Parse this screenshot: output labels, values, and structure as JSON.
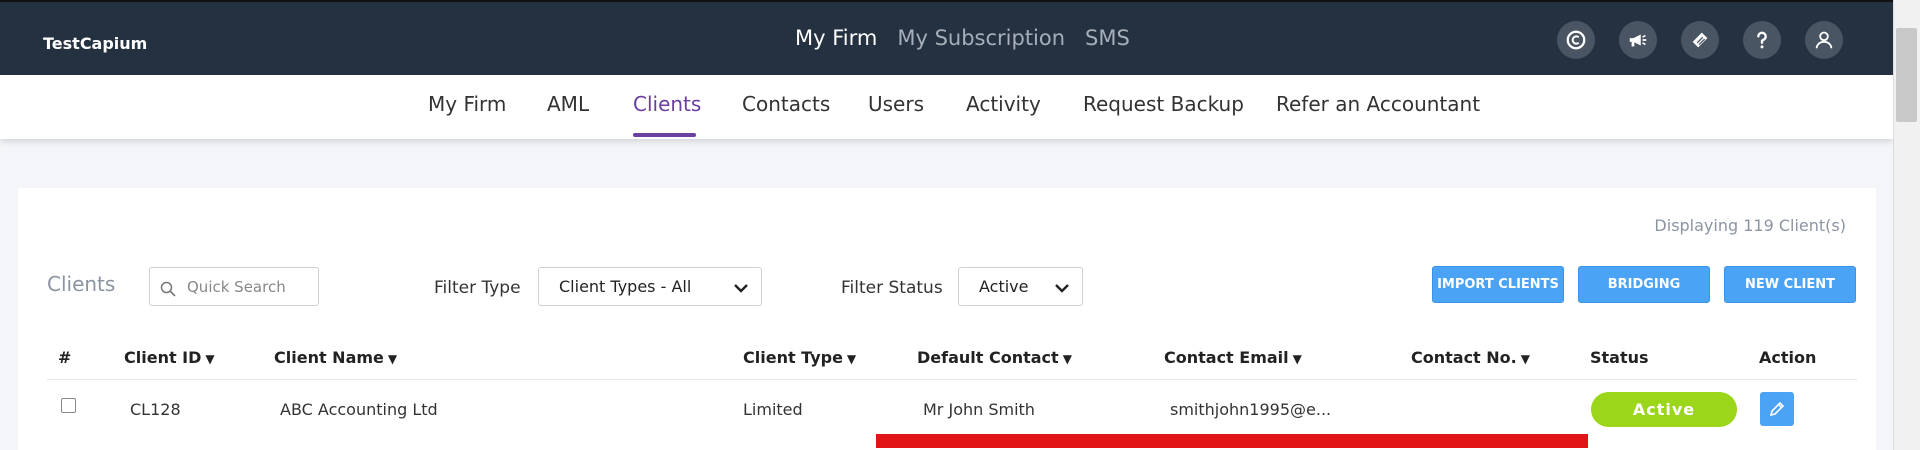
{
  "brand": "TestCapium",
  "top_nav": [
    "My Firm",
    "My Subscription",
    "SMS"
  ],
  "top_nav_active": 0,
  "top_icons": [
    "capium-icon",
    "megaphone-icon",
    "ticket-icon",
    "help-icon",
    "user-icon"
  ],
  "sub_nav": [
    "My Firm",
    "AML",
    "Clients",
    "Contacts",
    "Users",
    "Activity",
    "Request Backup",
    "Refer an Accountant"
  ],
  "sub_nav_active": "Clients",
  "displaying": "Displaying 119 Client(s)",
  "clients_label": "Clients",
  "search_placeholder": "Quick Search",
  "filter_type_label": "Filter Type",
  "filter_type_value": "Client Types - All",
  "filter_status_label": "Filter Status",
  "filter_status_value": "Active",
  "buttons": {
    "import": "IMPORT CLIENTS",
    "bridging": "BRIDGING",
    "new": "NEW CLIENT"
  },
  "columns": {
    "num": "#",
    "client_id": "Client ID",
    "client_name": "Client Name",
    "client_type": "Client Type",
    "default_contact": "Default Contact",
    "contact_email": "Contact Email",
    "contact_no": "Contact No.",
    "status": "Status",
    "action": "Action"
  },
  "sort_arrow": "▼",
  "rows": [
    {
      "client_id": "CL128",
      "client_name": "ABC Accounting Ltd",
      "client_type": "Limited",
      "default_contact": "Mr John Smith",
      "contact_email": "smithjohn1995@e...",
      "contact_no": "",
      "status": "Active"
    }
  ],
  "colors": {
    "topbar": "#243140",
    "accent": "#6b3fa0",
    "button": "#4ba3f5",
    "status_active": "#9bd61a",
    "annotation": "#e11515"
  }
}
